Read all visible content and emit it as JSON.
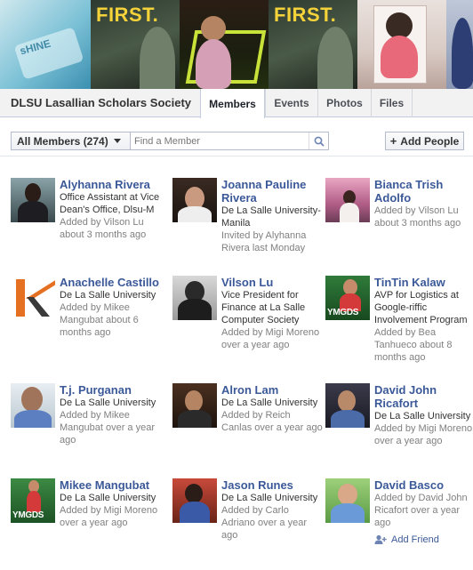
{
  "cover": {
    "first_text": "FIRST.",
    "tile_text": "sHINE"
  },
  "group": {
    "name": "DLSU Lasallian Scholars Society"
  },
  "tabs": [
    {
      "label": "Members",
      "active": true
    },
    {
      "label": "Events",
      "active": false
    },
    {
      "label": "Photos",
      "active": false
    },
    {
      "label": "Files",
      "active": false
    }
  ],
  "toolbar": {
    "filter_label": "All Members (274)",
    "search_placeholder": "Find a Member",
    "search_value": "",
    "add_people_label": "Add People"
  },
  "members": [
    {
      "name": "Alyhanna Rivera",
      "lines": [
        "Office Assistant at Vice Dean's Office, Dlsu-M"
      ],
      "gray": [
        "Added by Vilson Lu about 3 months ago"
      ]
    },
    {
      "name": "Joanna Pauline Rivera",
      "lines": [
        "De La Salle University-Manila"
      ],
      "gray": [
        "Invited by Alyhanna Rivera last Monday"
      ]
    },
    {
      "name": "Bianca Trish Adolfo",
      "lines": [],
      "gray": [
        "Added by Vilson Lu about 3 months ago"
      ]
    },
    {
      "name": "Anachelle Castillo",
      "lines": [
        "De La Salle University"
      ],
      "gray": [
        "Added by Mikee Mangubat about 6 months ago"
      ]
    },
    {
      "name": "Vilson Lu",
      "lines": [
        "Vice President for Finance at La Salle Computer Society"
      ],
      "gray": [
        "Added by Migi Moreno over a year ago"
      ]
    },
    {
      "name": "TinTin Kalaw",
      "lines": [
        "AVP for Logistics at Google-riffic Involvement Program"
      ],
      "gray": [
        "Added by Bea Tanhueco about 8 months ago"
      ]
    },
    {
      "name": "T.j. Purganan",
      "lines": [
        "De La Salle University"
      ],
      "gray": [
        "Added by Mikee Mangubat over a year ago"
      ]
    },
    {
      "name": "Alron Lam",
      "lines": [
        "De La Salle University"
      ],
      "gray": [
        "Added by Reich Canlas over a year ago"
      ]
    },
    {
      "name": "David John Ricafort",
      "lines": [
        "De La Salle University"
      ],
      "gray": [
        "Added by Migi Moreno over a year ago"
      ]
    },
    {
      "name": "Mikee Mangubat",
      "lines": [
        "De La Salle University"
      ],
      "gray": [
        "Added by Migi Moreno over a year ago"
      ]
    },
    {
      "name": "Jason Runes",
      "lines": [
        "De La Salle University"
      ],
      "gray": [
        "Added by Carlo Adriano over a year ago"
      ]
    },
    {
      "name": "David Basco",
      "lines": [],
      "gray": [
        "Added by David John Ricafort over a year ago"
      ],
      "add_friend": "Add Friend"
    }
  ],
  "badges": {
    "ymgds": "YMGDS"
  },
  "colors": {
    "link": "#3b5998",
    "gray_text": "#808080",
    "tab_bar": "#f2f2f2",
    "cover_accent": "#f4d23a"
  },
  "icons": {
    "search": "search-icon",
    "dropdown": "chevron-down-icon",
    "add_people": "plus-icon",
    "add_friend": "add-friend-icon"
  }
}
